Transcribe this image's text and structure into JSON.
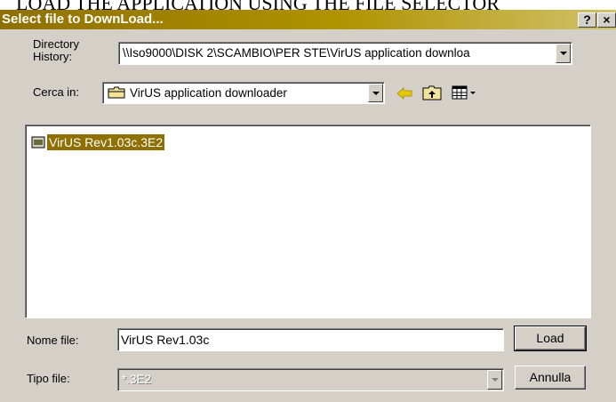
{
  "document": {
    "heading": "LOAD THE APPLICATION USING THE FILE SELECTOR"
  },
  "dialog": {
    "title": "Select file to DownLoad...",
    "help_label": "?",
    "close_label": "×"
  },
  "history": {
    "label_line1": "Directory",
    "label_line2": "History:",
    "value": "\\\\Iso9000\\DISK 2\\SCAMBIO\\PER STE\\VirUS application downloa"
  },
  "lookin": {
    "label": "Cerca in:",
    "value": "VirUS application downloader",
    "icons": [
      "folder-icon",
      "back-arrow-icon",
      "up-folder-icon",
      "view-menu-icon"
    ]
  },
  "files": [
    {
      "name": "VirUS Rev1.03c.3E2",
      "selected": true,
      "icon": "file-icon"
    }
  ],
  "filename": {
    "label": "Nome file:",
    "value": "VirUS Rev1.03c"
  },
  "filetype": {
    "label": "Tipo file:",
    "value": "*.3E2",
    "disabled": true
  },
  "buttons": {
    "load": "Load",
    "cancel": "Annulla"
  },
  "colors": {
    "titlebar_start": "#8f6f00",
    "titlebar_end": "#d0c26a",
    "selection": "#8f6f00",
    "face": "#d4d0c8",
    "arrow_accent": "#e8c800"
  }
}
